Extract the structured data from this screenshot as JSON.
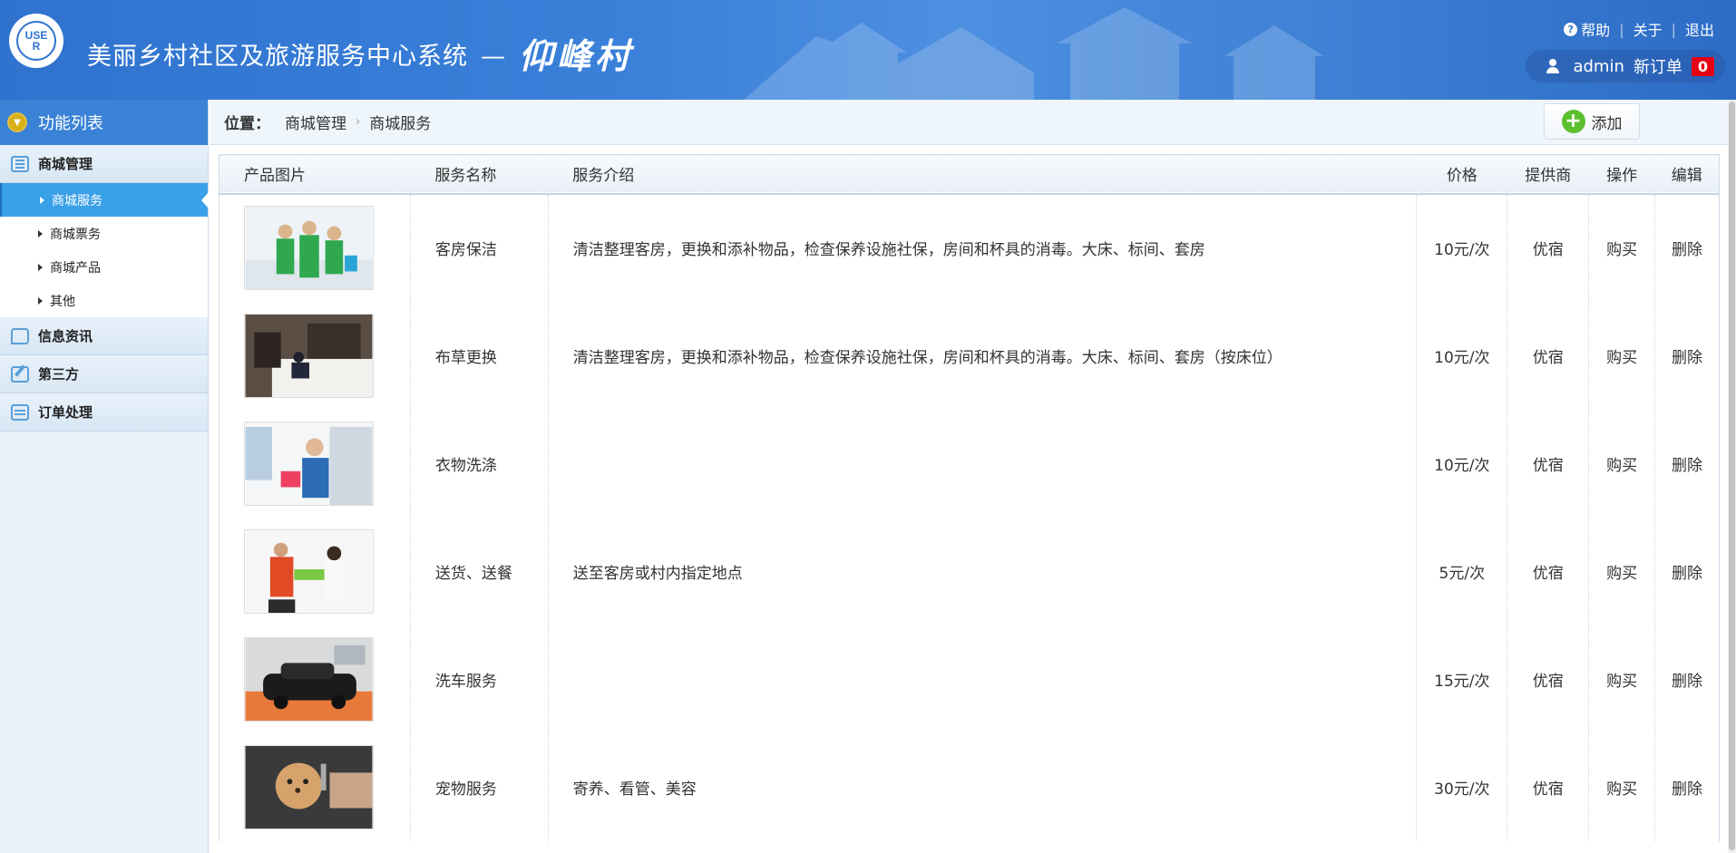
{
  "header": {
    "logo_text": "USER",
    "title": "美丽乡村社区及旅游服务中心系统",
    "dash": "—",
    "village": "仰峰村",
    "help": "帮助",
    "about": "关于",
    "logout": "退出",
    "username": "admin",
    "new_orders_label": "新订单",
    "new_orders_count": "0"
  },
  "sidebar": {
    "title": "功能列表",
    "groups": [
      {
        "label": "商城管理",
        "icon": "list-icon"
      },
      {
        "label": "信息资讯",
        "icon": "chat-icon"
      },
      {
        "label": "第三方",
        "icon": "edit-icon"
      },
      {
        "label": "订单处理",
        "icon": "calendar-icon"
      }
    ],
    "sub_items": [
      {
        "label": "商城服务",
        "active": true
      },
      {
        "label": "商城票务",
        "active": false
      },
      {
        "label": "商城产品",
        "active": false
      },
      {
        "label": "其他",
        "active": false
      }
    ]
  },
  "breadcrumb": {
    "prefix": "位置：",
    "items": [
      "商城管理",
      "商城服务"
    ]
  },
  "toolbar": {
    "add_label": "添加"
  },
  "table": {
    "headers": [
      "产品图片",
      "服务名称",
      "服务介绍",
      "价格",
      "提供商",
      "操作",
      "编辑"
    ],
    "rows": [
      {
        "name": "客房保洁",
        "desc": "清洁整理客房，更换和添补物品，检查保养设施社保，房间和杯具的消毒。大床、标间、套房",
        "price": "10元/次",
        "provider": "优宿",
        "op": "购买",
        "edit": "删除",
        "img": "cleaning-staff-photo"
      },
      {
        "name": "布草更换",
        "desc": "清洁整理客房，更换和添补物品，检查保养设施社保，房间和杯具的消毒。大床、标间、套房（按床位）",
        "price": "10元/次",
        "provider": "优宿",
        "op": "购买",
        "edit": "删除",
        "img": "bed-linen-photo"
      },
      {
        "name": "衣物洗涤",
        "desc": "",
        "price": "10元/次",
        "provider": "优宿",
        "op": "购买",
        "edit": "删除",
        "img": "laundry-photo"
      },
      {
        "name": "送货、送餐",
        "desc": "送至客房或村内指定地点",
        "price": "5元/次",
        "provider": "优宿",
        "op": "购买",
        "edit": "删除",
        "img": "delivery-photo"
      },
      {
        "name": "洗车服务",
        "desc": "",
        "price": "15元/次",
        "provider": "优宿",
        "op": "购买",
        "edit": "删除",
        "img": "car-wash-photo"
      },
      {
        "name": "宠物服务",
        "desc": "寄养、看管、美容",
        "price": "30元/次",
        "provider": "优宿",
        "op": "购买",
        "edit": "删除",
        "img": "pet-grooming-photo"
      }
    ]
  }
}
